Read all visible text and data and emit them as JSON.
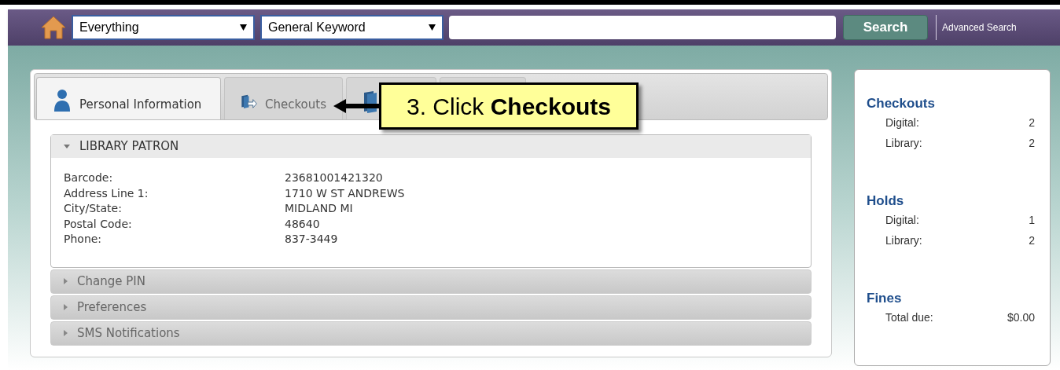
{
  "search_bar": {
    "scope": "Everything",
    "search_type": "General Keyword",
    "search_button": "Search",
    "advanced_link": "Advanced Search"
  },
  "tabs": [
    {
      "label": "Personal Information",
      "kind": "person",
      "selected": true
    },
    {
      "label": "Checkouts",
      "kind": "checkout",
      "selected": false
    },
    {
      "kind": "book",
      "selected": false
    },
    {
      "kind": "blank",
      "selected": false
    }
  ],
  "callout": {
    "text": "3. Click **Checkouts**"
  },
  "sections": [
    {
      "title": "LIBRARY PATRON",
      "expanded": true,
      "fields": [
        {
          "label": "Barcode:",
          "value": "23681001421320"
        },
        {
          "label": "Address Line 1:",
          "value": "1710 W ST ANDREWS"
        },
        {
          "label": "City/State:",
          "value": "MIDLAND MI"
        },
        {
          "label": "Postal Code:",
          "value": "48640"
        },
        {
          "label": "Phone:",
          "value": "837-3449"
        }
      ]
    },
    {
      "title": "Change PIN",
      "expanded": false
    },
    {
      "title": "Preferences",
      "expanded": false
    },
    {
      "title": "SMS Notifications",
      "expanded": false
    }
  ],
  "summary": [
    {
      "title": "Checkouts",
      "rows": [
        {
          "label": "Digital:",
          "value": "2"
        },
        {
          "label": "Library:",
          "value": "2"
        }
      ]
    },
    {
      "title": "Holds",
      "rows": [
        {
          "label": "Digital:",
          "value": "1"
        },
        {
          "label": "Library:",
          "value": "2"
        }
      ]
    },
    {
      "title": "Fines",
      "rows": [
        {
          "label": "Total due:",
          "value": "$0.00"
        }
      ]
    }
  ]
}
